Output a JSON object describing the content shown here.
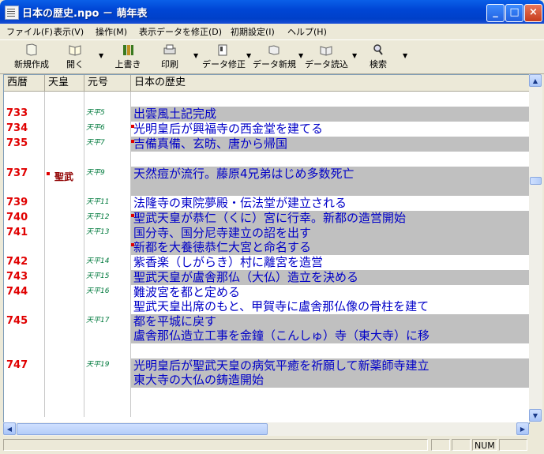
{
  "window": {
    "title": "日本の歴史.npo － 萌年表"
  },
  "title_buttons": {
    "minimize": "_",
    "maximize": "□",
    "close": "×"
  },
  "menu": [
    "ファイル(F)",
    "表示(V)",
    "操作(M)",
    "表示データを修正(D)",
    "初期設定(I)",
    "ヘルプ(H)"
  ],
  "toolbar": {
    "new": "新規作成",
    "open": "開く",
    "overwrite": "上書き",
    "print": "印刷",
    "data_edit": "データ修正",
    "data_new": "データ新規",
    "data_read": "データ読込",
    "search": "検索"
  },
  "columns": {
    "year": "西暦",
    "emperor": "天皇",
    "era": "元号",
    "history": "日本の歴史"
  },
  "rows": [
    {
      "year": "",
      "emperor": "",
      "era": "",
      "lines": [
        ""
      ],
      "grey": false
    },
    {
      "year": "733",
      "emperor": "",
      "era": "天平5",
      "lines": [
        "出雲風土記完成"
      ],
      "grey": true,
      "mark": false
    },
    {
      "year": "734",
      "emperor": "",
      "era": "天平6",
      "lines": [
        "光明皇后が興福寺の西金堂を建てる"
      ],
      "grey": false,
      "mark": true
    },
    {
      "year": "735",
      "emperor": "",
      "era": "天平7",
      "lines": [
        "吉備真備、玄昉、唐から帰国"
      ],
      "grey": true,
      "mark": true
    },
    {
      "year": "",
      "emperor": "",
      "era": "",
      "lines": [
        ""
      ],
      "grey": false
    },
    {
      "year": "737",
      "emperor": "聖武",
      "era": "天平9",
      "lines": [
        "天然痘が流行。藤原4兄弟はじめ多数死亡",
        ""
      ],
      "grey": true,
      "mark": false
    },
    {
      "year": "739",
      "emperor": "",
      "era": "天平11",
      "lines": [
        "法隆寺の東院夢殿・伝法堂が建立される"
      ],
      "grey": false,
      "mark": false
    },
    {
      "year": "740",
      "emperor": "",
      "era": "天平12",
      "lines": [
        "聖武天皇が恭仁（くに）宮に行幸。新都の造営開始"
      ],
      "grey": true,
      "mark": true
    },
    {
      "year": "741",
      "emperor": "",
      "era": "天平13",
      "lines": [
        "国分寺、国分尼寺建立の詔を出す",
        "新都を大養徳恭仁大宮と命名する"
      ],
      "grey": true,
      "mark": false,
      "mark2": true
    },
    {
      "year": "742",
      "emperor": "",
      "era": "天平14",
      "lines": [
        "紫香楽（しがらき）村に離宮を造営"
      ],
      "grey": false,
      "mark": false
    },
    {
      "year": "743",
      "emperor": "",
      "era": "天平15",
      "lines": [
        "聖武天皇が盧舎那仏（大仏）造立を決める"
      ],
      "grey": true,
      "mark": false
    },
    {
      "year": "744",
      "emperor": "",
      "era": "天平16",
      "lines": [
        "難波宮を都と定める",
        "聖武天皇出席のもと、甲賀寺に盧舎那仏像の骨柱を建て"
      ],
      "grey": false,
      "mark": false
    },
    {
      "year": "745",
      "emperor": "",
      "era": "天平17",
      "lines": [
        "都を平城に戻す",
        "盧舎那仏造立工事を金鐘（こんしゅ）寺（東大寺）に移"
      ],
      "grey": true,
      "mark": false
    },
    {
      "year": "",
      "emperor": "",
      "era": "",
      "lines": [
        ""
      ],
      "grey": false
    },
    {
      "year": "747",
      "emperor": "",
      "era": "天平19",
      "lines": [
        "光明皇后が聖武天皇の病気平癒を祈願して新薬師寺建立",
        "東大寺の大仏の鋳造開始"
      ],
      "grey": true,
      "mark": false
    },
    {
      "year": "",
      "emperor": "",
      "era": "",
      "lines": [
        "",
        ""
      ],
      "grey": false
    }
  ],
  "status": {
    "num": "NUM"
  }
}
